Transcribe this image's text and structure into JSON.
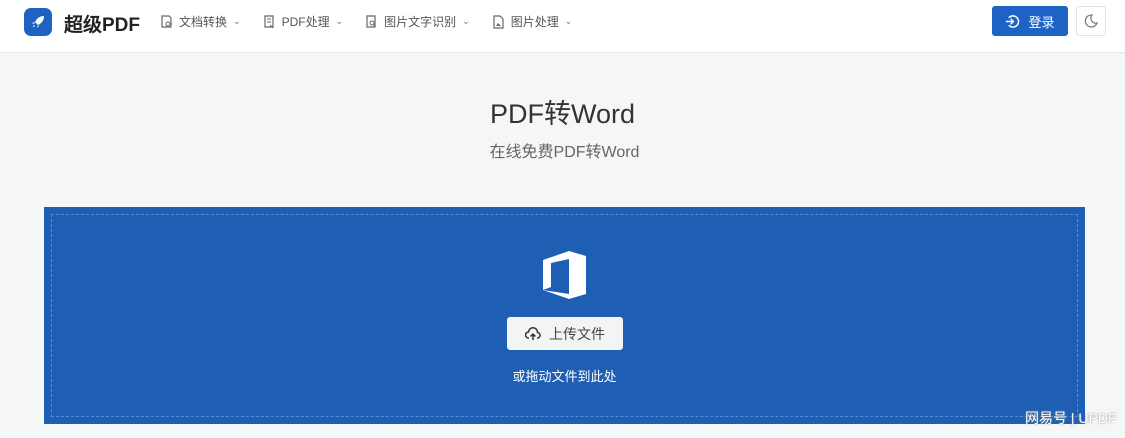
{
  "header": {
    "brand": "超级PDF",
    "nav": [
      {
        "label": "文档转换"
      },
      {
        "label": "PDF处理"
      },
      {
        "label": "图片文字识别"
      },
      {
        "label": "图片处理"
      }
    ],
    "login_label": "登录"
  },
  "main": {
    "title": "PDF转Word",
    "subtitle": "在线免费PDF转Word",
    "upload_label": "上传文件",
    "drop_hint": "或拖动文件到此处"
  },
  "watermark": "网易号 | UPDF",
  "colors": {
    "accent": "#1e63c4",
    "drop_bg": "#1e5fb4"
  }
}
